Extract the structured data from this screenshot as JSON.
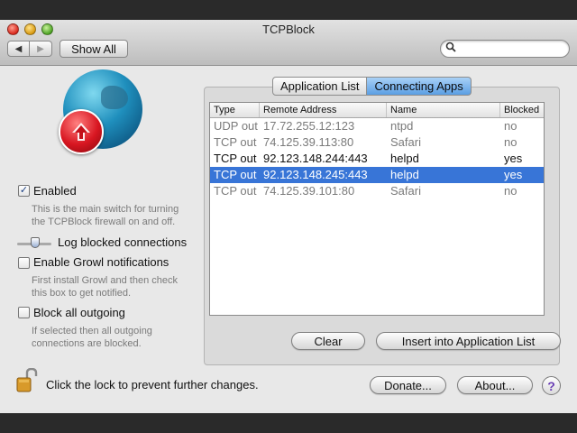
{
  "window": {
    "title": "TCPBlock"
  },
  "toolbar": {
    "show_all_label": "Show All",
    "back_icon": "◀",
    "forward_icon": "▶",
    "search_placeholder": ""
  },
  "options": {
    "enabled": {
      "label": "Enabled",
      "checked": true,
      "description": "This is the main switch for turning the TCPBlock firewall on and off."
    },
    "log": {
      "label": "Log blocked connections"
    },
    "growl": {
      "label": "Enable Growl notifications",
      "checked": false,
      "description": "First install Growl and then check this box to get notified."
    },
    "block_all": {
      "label": "Block all outgoing",
      "checked": false,
      "description": "If selected then all outgoing connections are blocked."
    }
  },
  "tabs": [
    {
      "label": "Application List",
      "selected": false
    },
    {
      "label": "Connecting Apps",
      "selected": true
    }
  ],
  "table": {
    "columns": [
      "Type",
      "Remote Address",
      "Name",
      "Blocked"
    ],
    "rows": [
      {
        "type": "UDP out",
        "address": "17.72.255.12:123",
        "name": "ntpd",
        "blocked": "no",
        "selected": false
      },
      {
        "type": "TCP out",
        "address": "74.125.39.113:80",
        "name": "Safari",
        "blocked": "no",
        "selected": false
      },
      {
        "type": "TCP out",
        "address": "92.123.148.244:443",
        "name": "helpd",
        "blocked": "yes",
        "selected": false
      },
      {
        "type": "TCP out",
        "address": "92.123.148.245:443",
        "name": "helpd",
        "blocked": "yes",
        "selected": true
      },
      {
        "type": "TCP out",
        "address": "74.125.39.101:80",
        "name": "Safari",
        "blocked": "no",
        "selected": false
      }
    ]
  },
  "actions": {
    "clear_label": "Clear",
    "insert_label": "Insert into Application List"
  },
  "footer": {
    "lock_text": "Click the lock to prevent further changes.",
    "donate_label": "Donate...",
    "about_label": "About...",
    "help_label": "?"
  },
  "colors": {
    "selection": "#3875d7",
    "tab_selected": "#5b9ee3",
    "badge": "#d81621"
  }
}
